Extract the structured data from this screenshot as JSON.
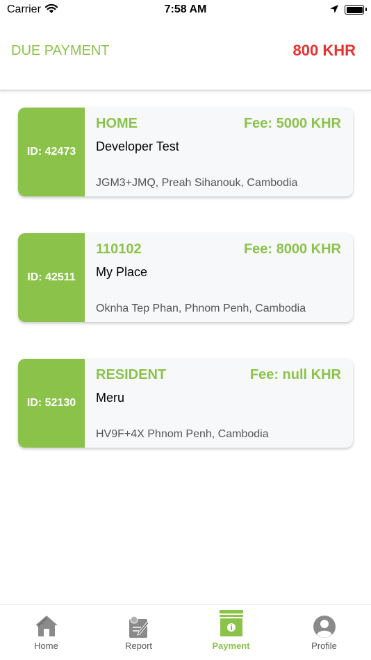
{
  "status_bar": {
    "carrier": "Carrier",
    "time": "7:58 AM"
  },
  "header": {
    "title": "DUE PAYMENT",
    "amount": "800 KHR",
    "amount_color": "#e8312f",
    "accent_color": "#8bc34a"
  },
  "cards": [
    {
      "id": "ID: 42473",
      "type": "HOME",
      "fee": "Fee: 5000 KHR",
      "name": "Developer Test",
      "address": "JGM3+JMQ, Preah Sihanouk, Cambodia"
    },
    {
      "id": "ID: 42511",
      "type": "110102",
      "fee": "Fee: 8000 KHR",
      "name": "My Place",
      "address": "Oknha Tep Phan, Phnom Penh, Cambodia"
    },
    {
      "id": "ID: 52130",
      "type": "RESIDENT",
      "fee": "Fee: null KHR",
      "name": "Meru",
      "address": "HV9F+4X Phnom Penh, Cambodia"
    }
  ],
  "tabs": [
    {
      "label": "Home",
      "icon": "home-icon"
    },
    {
      "label": "Report",
      "icon": "report-icon"
    },
    {
      "label": "Payment",
      "icon": "payment-icon",
      "active": true
    },
    {
      "label": "Profile",
      "icon": "profile-icon"
    }
  ]
}
